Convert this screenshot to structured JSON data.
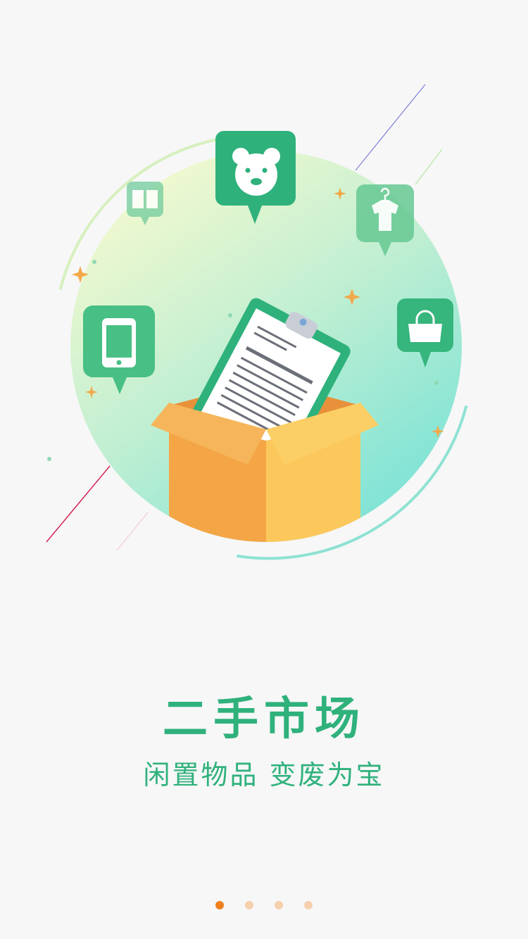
{
  "onboarding": {
    "title": "二手市场",
    "subtitle": "闲置物品 变废为宝",
    "page_indicator": {
      "total": 4,
      "current": 1
    }
  },
  "colors": {
    "accent_green": "#2fb17c",
    "dot_active": "#ef7f1e",
    "dot_inactive": "#f6cfae"
  },
  "icons": [
    "bear-toy-icon",
    "book-icon",
    "clothes-icon",
    "phone-icon",
    "handbag-icon",
    "clipboard-icon",
    "box-icon"
  ]
}
